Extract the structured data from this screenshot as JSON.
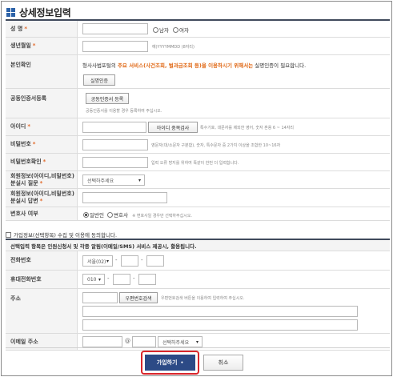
{
  "title": "상세정보입력",
  "colors": {
    "accent": "#2c62a8",
    "required": "#e26b2c",
    "highlight": "#e06a18",
    "submit_bg": "#2c4a86",
    "submit_frame": "#d9262c"
  },
  "name": {
    "label": "성 명",
    "req": "*",
    "male": "남자",
    "female": "여자"
  },
  "birth": {
    "label": "생년월일",
    "req": "*",
    "hint": "예)YYYYMMDD (8자리)"
  },
  "auth": {
    "label": "본인확인",
    "text_pre": "형사사법포털의 ",
    "text_hl": "주요 서비스(사건조회, 벌과금조회 등)을 이용하시기 위해서는",
    "text_post": " 실명인증이 필요합니다.",
    "button": "실명인증"
  },
  "cert": {
    "label": "공동인증서등록",
    "button": "공동인증서 등록",
    "hint": "공동인증서를 이용할 경우 등록하여 주십시오."
  },
  "userid": {
    "label": "아이디",
    "req": "*",
    "button": "아이디 중복검사",
    "hint": "특수기호, 대문자를 제외한 영어, 숫자 혼용 6 ~ 14자리"
  },
  "password": {
    "label": "비밀번호",
    "req": "*",
    "hint": "영문자(대/소문자 구분함), 숫자, 특수문자 중 2가지 이상을 조합한 10~16자"
  },
  "password_confirm": {
    "label": "비밀번호확인",
    "req": "*",
    "hint": "입력 오류 방지를 위하여 똑같이 한번 더 입력합니다."
  },
  "question": {
    "label_line1": "회원정보(아이디,비밀번호)",
    "label_line2": "분실시 질문",
    "req": "*",
    "selected": "선택하주세요"
  },
  "answer": {
    "label_line1": "회원정보(아이디,비밀번호)",
    "label_line2": "분실시 답변",
    "req": "*"
  },
  "lawyer": {
    "label": "변호사 여부",
    "general": "일반인",
    "lawyer": "변호사",
    "hint": "※ 변호사일 경우만 선택하주십시오."
  },
  "consent": {
    "text": "가입정보(선택항목) 수집 및 이용에 동의합니다."
  },
  "optional_notice": "선택입력 항목은 인원신청서 및 각종 알림(이메일/SMS) 서비스 제공시, 활용됩니다.",
  "phone": {
    "label": "전화번호",
    "area": "서울(02)",
    "dash": "-"
  },
  "mobile": {
    "label": "휴대전화번호",
    "prefix": "010",
    "dash": "-"
  },
  "address": {
    "label": "주소",
    "button": "우편번호검색",
    "hint": "우편번호검색 버튼을 이용하여 입력하여 주십시오."
  },
  "email": {
    "label": "이메일 주소",
    "at": "@",
    "domain": "선택하주세요"
  },
  "footer": {
    "submit": "가입하기",
    "submit_mark": "•",
    "cancel": "취소"
  }
}
